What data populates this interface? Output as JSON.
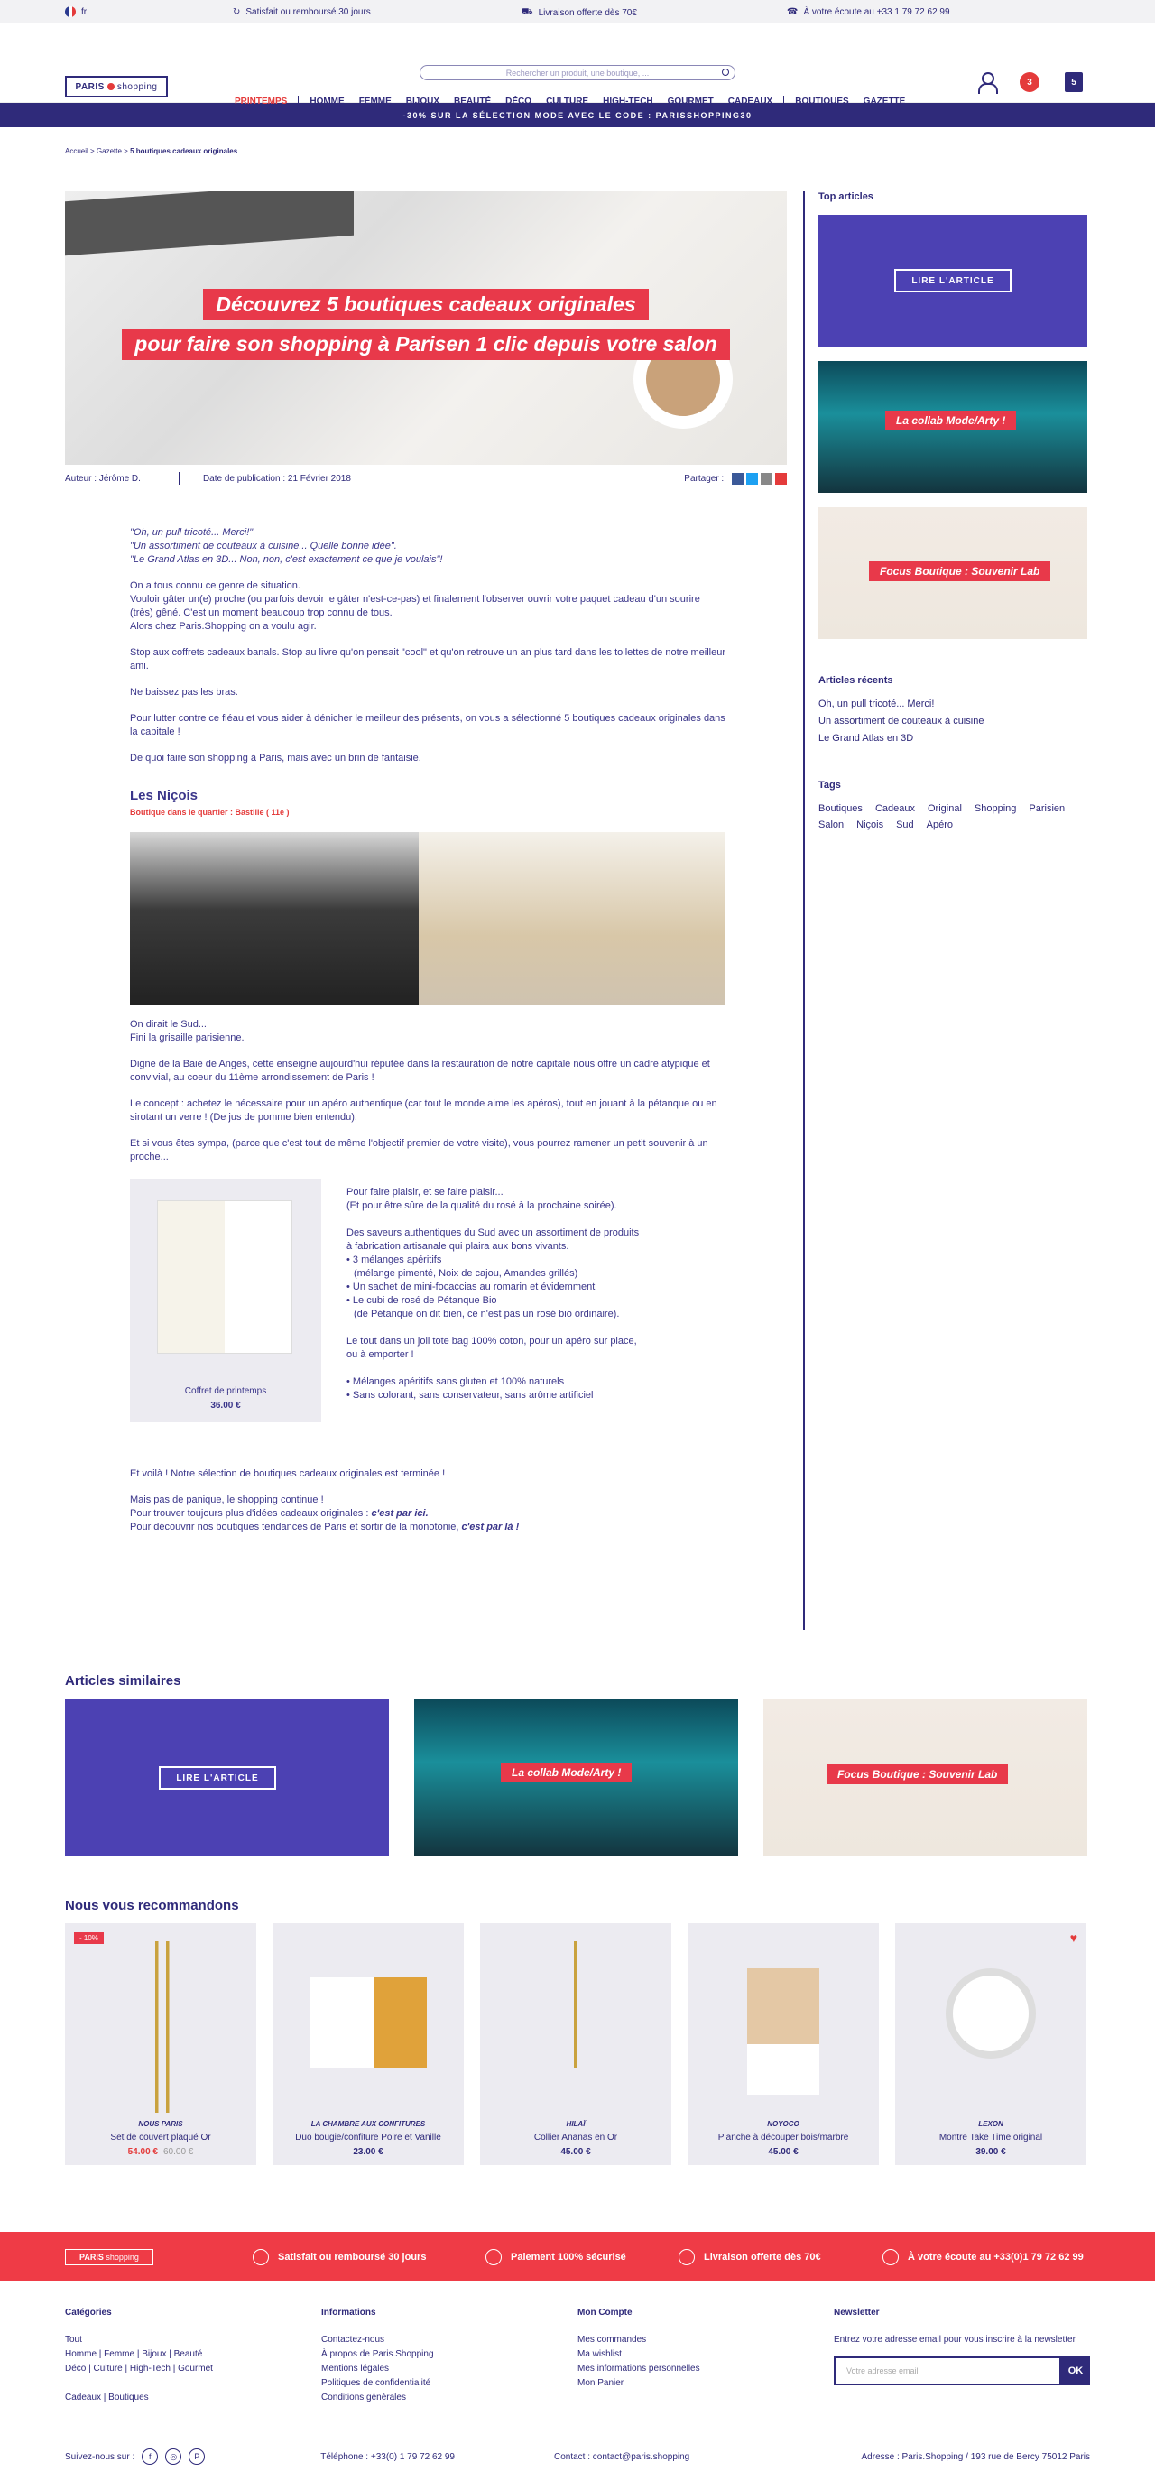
{
  "topbar": {
    "lang": "fr",
    "i1": "Satisfait ou remboursé 30 jours",
    "i2": "Livraison offerte dès 70€",
    "i3": "À votre écoute au +33 1 79 72 62 99"
  },
  "header": {
    "logo_a": "PARIS",
    "logo_b": "shopping",
    "search_placeholder": "Rechercher un produit, une boutique, ...",
    "wish_count": "3",
    "cart_count": "5",
    "nav": [
      "PRINTEMPS",
      "HOMME",
      "FEMME",
      "BIJOUX",
      "BEAUTÉ",
      "DÉCO",
      "CULTURE",
      "HIGH-TECH",
      "GOURMET",
      "CADEAUX",
      "BOUTIQUES",
      "GAZETTE"
    ]
  },
  "promo": "-30% SUR LA SÉLECTION MODE AVEC LE CODE : PARISSHOPPING30",
  "crumb": {
    "a": "Accueil",
    "b": "Gazette",
    "c": "5 boutiques cadeaux originales"
  },
  "hero": {
    "l1": "Découvrez 5 boutiques cadeaux originales",
    "l2": "pour faire son shopping à Parisen 1 clic depuis votre salon"
  },
  "meta": {
    "author_label": "Auteur :",
    "author": "Jérôme D.",
    "date_label": "Date de publication :",
    "date": "21 Février 2018",
    "share": "Partager :"
  },
  "article": {
    "q1": "\"Oh, un pull tricoté... Merci!\"",
    "q2": "\"Un assortiment de couteaux à cuisine... Quelle bonne idée\".",
    "q3": "\"Le Grand Atlas en 3D... Non, non, c'est exactement ce que je voulais\"!",
    "p1": "On a tous connu ce genre de situation.",
    "p2": "Vouloir gâter un(e) proche (ou parfois devoir le gâter n'est-ce-pas) et finalement l'observer ouvrir votre paquet cadeau d'un sourire (très) gêné. C'est un moment beaucoup trop connu de tous.",
    "p3": "Alors chez Paris.Shopping on a voulu agir.",
    "p4": "Stop aux coffrets cadeaux banals. Stop au livre qu'on pensait \"cool\" et qu'on retrouve un an plus tard dans les toilettes de notre meilleur ami.",
    "p5": "Ne baissez pas les bras.",
    "p6": "Pour lutter contre ce fléau et vous aider à dénicher le meilleur des présents, on vous a sélectionné 5 boutiques cadeaux originales dans la capitale !",
    "p7": "De quoi faire son shopping à Paris, mais avec un brin de fantaisie.",
    "shop": "Les Niçois",
    "shopsub": "Boutique dans le quartier : Bastille ( 11e )",
    "p8": "On dirait le Sud...",
    "p9": "Fini la grisaille parisienne.",
    "p10": "Digne de la Baie de Anges, cette enseigne aujourd'hui réputée dans la restauration de notre capitale nous offre un cadre atypique et convivial, au coeur du 11ème arrondissement de Paris !",
    "p11": "Le concept : achetez le nécessaire pour un apéro authentique (car tout le monde aime les apéros), tout en jouant à la pétanque ou en sirotant un verre ! (De jus de pomme bien entendu).",
    "p12": "Et si vous êtes sympa, (parce que c'est tout de même l'objectif premier de votre visite), vous pourrez ramener un petit souvenir à un proche...",
    "pname": "Coffret de printemps",
    "pprice": "36.00 €",
    "d1": "Pour faire plaisir, et se faire plaisir...",
    "d2": "(Et pour être sûre de la qualité du rosé à la prochaine soirée).",
    "d3": "Des saveurs authentiques du Sud avec un assortiment de produits",
    "d4": "à fabrication artisanale qui plaira aux bons vivants.",
    "d5": "• 3 mélanges apéritifs",
    "d6": "(mélange pimenté, Noix de cajou, Amandes grillés)",
    "d7": "• Un sachet de mini-focaccias au romarin et évidemment",
    "d8": "• Le cubi de rosé de Pétanque Bio",
    "d9": "(de Pétanque on dit bien, ce n'est pas un rosé bio ordinaire).",
    "d10": "Le tout dans un joli tote bag 100% coton, pour un apéro sur place,",
    "d11": "ou à emporter !",
    "d12": "• Mélanges apéritifs sans gluten et 100% naturels",
    "d13": "• Sans colorant, sans conservateur, sans arôme artificiel",
    "e1": "Et voilà ! Notre sélection de boutiques cadeaux originales est terminée !",
    "e2": "Mais pas de panique, le shopping continue !",
    "e3": "Pour trouver toujours plus d'idées cadeaux originales :",
    "e3b": "c'est par ici.",
    "e4": "Pour découvrir nos boutiques tendances de Paris et sortir de la monotonie,",
    "e4b": "c'est par là !"
  },
  "side": {
    "top": "Top articles",
    "btn": "LIRE L'ARTICLE",
    "t2": "La collab Mode/Arty !",
    "t3": "Focus Boutique : Souvenir Lab",
    "recent": "Articles récents",
    "recents": [
      "Oh, un pull tricoté... Merci!",
      "Un assortiment de couteaux à cuisine",
      "Le Grand Atlas en 3D"
    ],
    "tags_title": "Tags",
    "tags": [
      "Boutiques",
      "Cadeaux",
      "Original",
      "Shopping",
      "Parisien",
      "Salon",
      "Niçois",
      "Sud",
      "Apéro"
    ]
  },
  "similar": "Articles similaires",
  "recommend": "Nous vous recommandons",
  "recs": [
    {
      "brand": "NOUS PARIS",
      "name": "Set de couvert plaqué Or",
      "price": "54.00 €",
      "old": "60.00 €",
      "disc": "- 10%"
    },
    {
      "brand": "LA CHAMBRE AUX CONFITURES",
      "name": "Duo bougie/confiture Poire et Vanille",
      "price": "23.00 €"
    },
    {
      "brand": "HILAÏ",
      "name": "Collier Ananas en Or",
      "price": "45.00 €"
    },
    {
      "brand": "NOYOCO",
      "name": "Planche à découper bois/marbre",
      "price": "45.00 €"
    },
    {
      "brand": "LEXON",
      "name": "Montre Take Time original",
      "price": "39.00 €"
    }
  ],
  "footband": {
    "a": "Satisfait ou remboursé 30 jours",
    "b": "Paiement 100% sécurisé",
    "c": "Livraison offerte dès 70€",
    "d": "À votre écoute au +33(0)1 79 72 62 99"
  },
  "footer": {
    "cat": "Catégories",
    "cat_items": [
      "Tout",
      "Homme | Femme | Bijoux | Beauté",
      "Déco | Culture | High-Tech | Gourmet",
      "",
      "Cadeaux | Boutiques"
    ],
    "info": "Informations",
    "info_items": [
      "Contactez-nous",
      "À propos de Paris.Shopping",
      "Mentions légales",
      "Politiques de confidentialité",
      "Conditions générales"
    ],
    "acc": "Mon Compte",
    "acc_items": [
      "Mes commandes",
      "Ma wishlist",
      "Mes informations personnelles",
      "Mon Panier"
    ],
    "nl": "Newsletter",
    "nl_text": "Entrez votre adresse email pour vous inscrire à la newsletter",
    "nl_ph": "Votre adresse email",
    "ok": "OK",
    "follow": "Suivez-nous sur :",
    "tel": "Téléphone : +33(0) 1 79 72 62 99",
    "contact": "Contact : contact@paris.shopping",
    "addr": "Adresse : Paris.Shopping / 193 rue de Bercy 75012 Paris"
  }
}
